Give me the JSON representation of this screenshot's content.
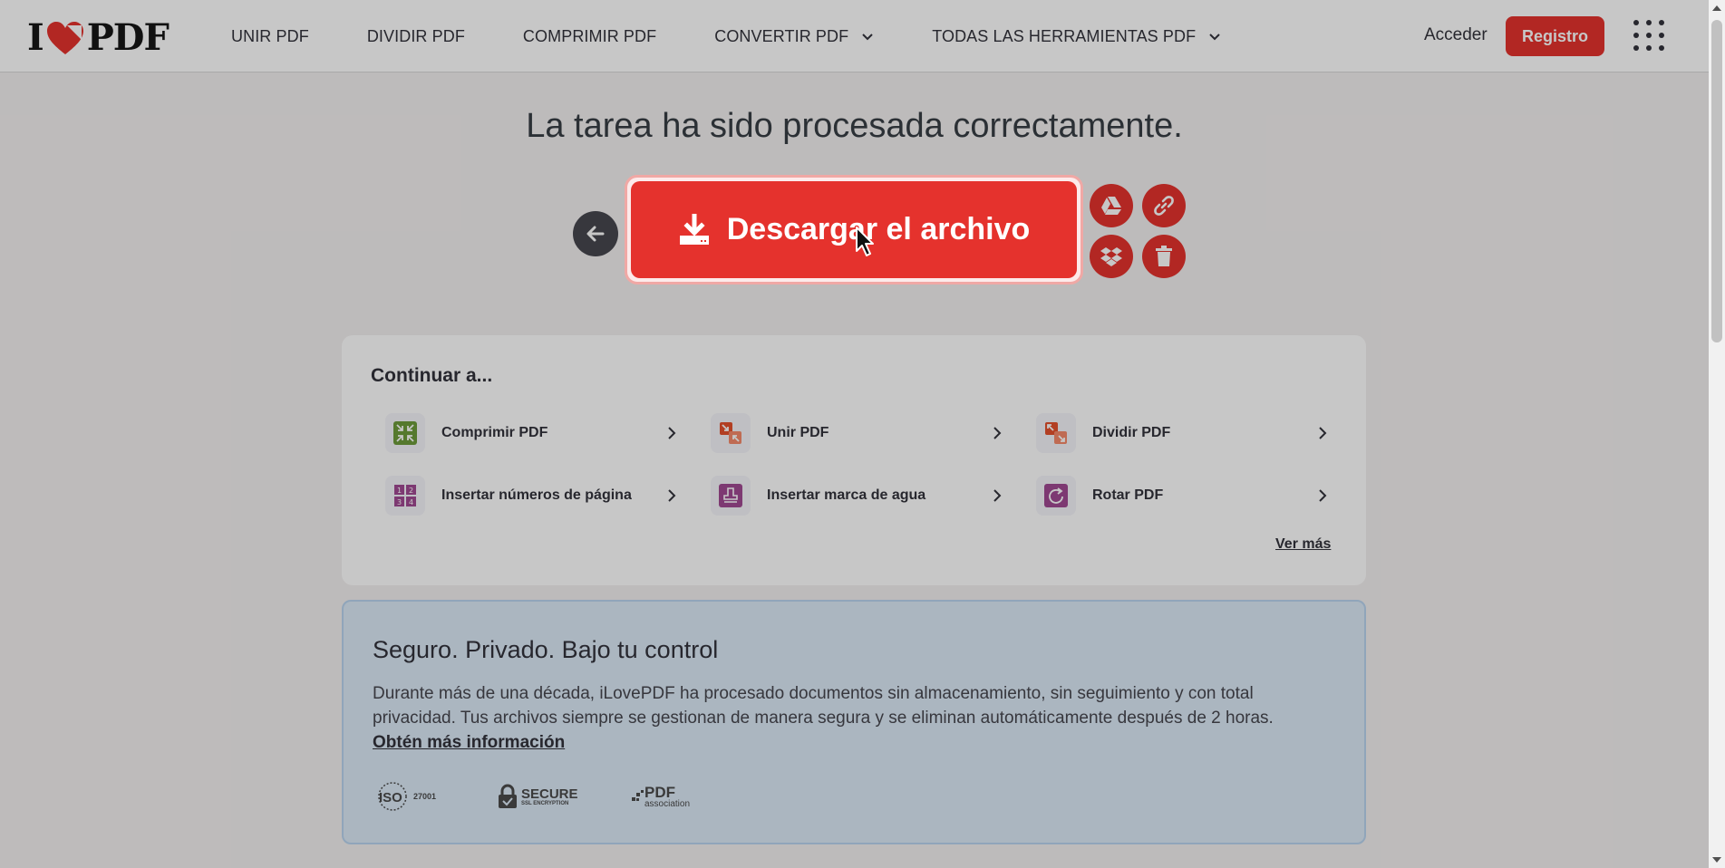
{
  "header": {
    "logo_left": "I",
    "logo_right": "PDF",
    "nav": [
      {
        "label": "UNIR PDF"
      },
      {
        "label": "DIVIDIR PDF"
      },
      {
        "label": "COMPRIMIR PDF"
      },
      {
        "label": "CONVERTIR PDF"
      },
      {
        "label": "TODAS LAS HERRAMIENTAS PDF"
      }
    ],
    "login": "Acceder",
    "register": "Registro"
  },
  "main": {
    "title": "La tarea ha sido procesada correctamente.",
    "download_label": "Descargar el archivo"
  },
  "continue": {
    "title": "Continuar a...",
    "tools": [
      {
        "label": "Comprimir PDF",
        "icon": "compress-icon",
        "color": "#6d9c3c"
      },
      {
        "label": "Unir PDF",
        "icon": "merge-icon",
        "color": "#e5512d"
      },
      {
        "label": "Dividir PDF",
        "icon": "split-icon",
        "color": "#e5512d"
      },
      {
        "label": "Insertar números de página",
        "icon": "page-numbers-icon",
        "color": "#a14a92"
      },
      {
        "label": "Insertar marca de agua",
        "icon": "watermark-icon",
        "color": "#a14a92"
      },
      {
        "label": "Rotar PDF",
        "icon": "rotate-icon",
        "color": "#a14a92"
      }
    ],
    "see_more": "Ver más"
  },
  "secure": {
    "title": "Seguro. Privado. Bajo tu control",
    "text": "Durante más de una década, iLovePDF ha procesado documentos sin almacenamiento, sin seguimiento y con total privacidad. Tus archivos siempre se gestionan de manera segura y se eliminan automáticamente después de 2 horas.",
    "link": "Obtén más información",
    "badges": {
      "iso": "ISO",
      "iso_num": "27001",
      "secure": "SECURE",
      "secure_sub": "SSL ENCRYPTION",
      "pdf": "PDF",
      "pdf_sub": "association"
    }
  },
  "colors": {
    "accent": "#e5322d",
    "text": "#33333b"
  }
}
